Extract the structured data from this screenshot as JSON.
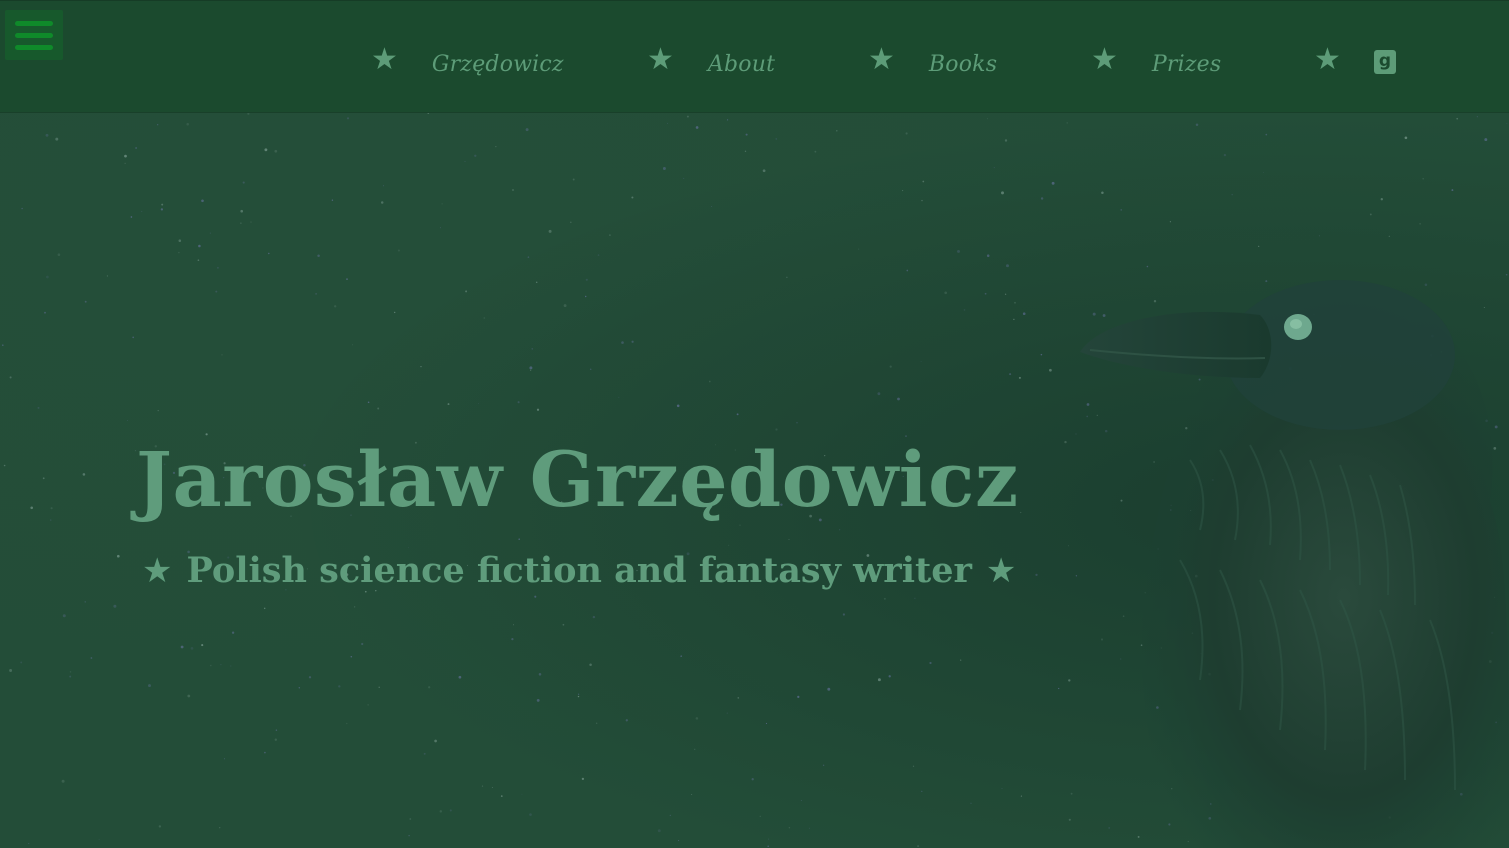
{
  "header": {
    "menu_toggle_icon": "hamburger-menu-icon",
    "nav": [
      {
        "label": "Grzędowicz",
        "icon": "star-icon"
      },
      {
        "label": "About",
        "icon": "star-icon"
      },
      {
        "label": "Books",
        "icon": "star-icon"
      },
      {
        "label": "Prizes",
        "icon": "star-icon"
      }
    ],
    "goodreads": {
      "icon": "goodreads-icon",
      "glyph": "g",
      "separator_icon": "star-icon"
    }
  },
  "hero": {
    "title": "Jarosław Grzędowicz",
    "subtitle": "Polish science fiction and fantasy writer",
    "background_image": "raven-on-starry-sky"
  },
  "colors": {
    "header_bg": "#1b4a2e",
    "page_bg": "#224c37",
    "text": "#5f9c7c",
    "menu_button": "#17592c",
    "menu_bars": "#0f8a2a"
  }
}
